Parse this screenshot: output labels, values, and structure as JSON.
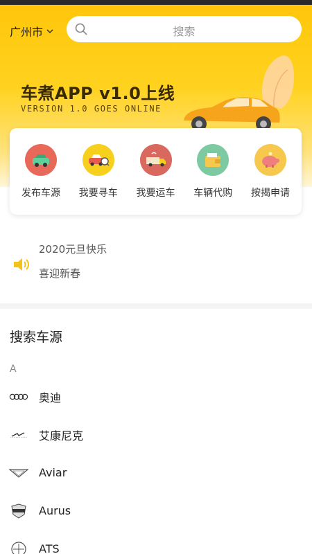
{
  "header": {
    "city": "广州市",
    "search_placeholder": "搜索"
  },
  "banner": {
    "title": "车煮APP v1.0上线",
    "subtitle": "VERSION 1.0 GOES ONLINE"
  },
  "menu": {
    "items": [
      {
        "label": "发布车源",
        "icon": "car-publish-icon",
        "color": "#e8685a"
      },
      {
        "label": "我要寻车",
        "icon": "car-search-icon",
        "color": "#f7cf1d"
      },
      {
        "label": "我要运车",
        "icon": "truck-icon",
        "color": "#d9685e"
      },
      {
        "label": "车辆代购",
        "icon": "wallet-icon",
        "color": "#7cc9a2"
      },
      {
        "label": "按揭申请",
        "icon": "piggy-bank-icon",
        "color": "#f6c84d"
      }
    ]
  },
  "notice": {
    "line1": "2020元旦快乐",
    "line2": "喜迎新春",
    "icon": "speaker-icon",
    "icon_color": "#f5c21a"
  },
  "brands": {
    "section_title": "搜索车源",
    "letter": "A",
    "items": [
      {
        "name": "奥迪",
        "logo": "audi-logo"
      },
      {
        "name": "艾康尼克",
        "logo": "iconiq-logo"
      },
      {
        "name": "Aviar",
        "logo": "aviar-logo"
      },
      {
        "name": "Aurus",
        "logo": "aurus-logo"
      },
      {
        "name": "ATS",
        "logo": "ats-logo"
      }
    ]
  },
  "colors": {
    "accent": "#ffc60b",
    "banner_car": "#f7a41d"
  }
}
